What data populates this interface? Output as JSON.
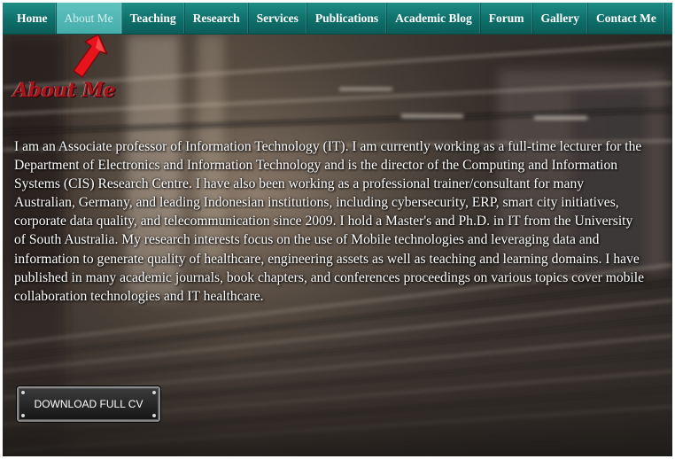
{
  "nav": {
    "items": [
      {
        "label": "Home"
      },
      {
        "label": "About Me"
      },
      {
        "label": "Teaching"
      },
      {
        "label": "Research"
      },
      {
        "label": "Services"
      },
      {
        "label": "Publications"
      },
      {
        "label": "Academic Blog"
      },
      {
        "label": "Forum"
      },
      {
        "label": "Gallery"
      },
      {
        "label": "Contact Me"
      }
    ],
    "active": "About Me"
  },
  "page": {
    "heading": "About Me",
    "bio": "I am an Associate professor of Information Technology (IT). I am currently working as a full-time lecturer for the Department of Electronics and Information Technology and is the director of the Computing and Information Systems (CIS) Research Centre. I have also been working as a professional trainer/consultant for many Australian, Germany, and leading Indonesian institutions, including cybersecurity, ERP, smart city initiatives, corporate data quality, and telecommunication since 2009. I hold a Master's and Ph.D. in IT from the University of South Australia. My research interests focus on the use of Mobile technologies and leveraging data and information to generate quality of healthcare, engineering assets as well as teaching and learning domains. I have published in many academic journals, book chapters, and conferences proceedings on various topics cover mobile collaboration technologies and IT healthcare.",
    "cv_button": "DOWNLOAD FULL CV"
  },
  "colors": {
    "nav_background": "#0f6f6a",
    "nav_active": "#46acaa",
    "heading": "#a8141c",
    "arrow": "#e8141c",
    "button_background": "#1e1e1e"
  },
  "icons": {
    "pointer": "red-arrow-icon"
  }
}
